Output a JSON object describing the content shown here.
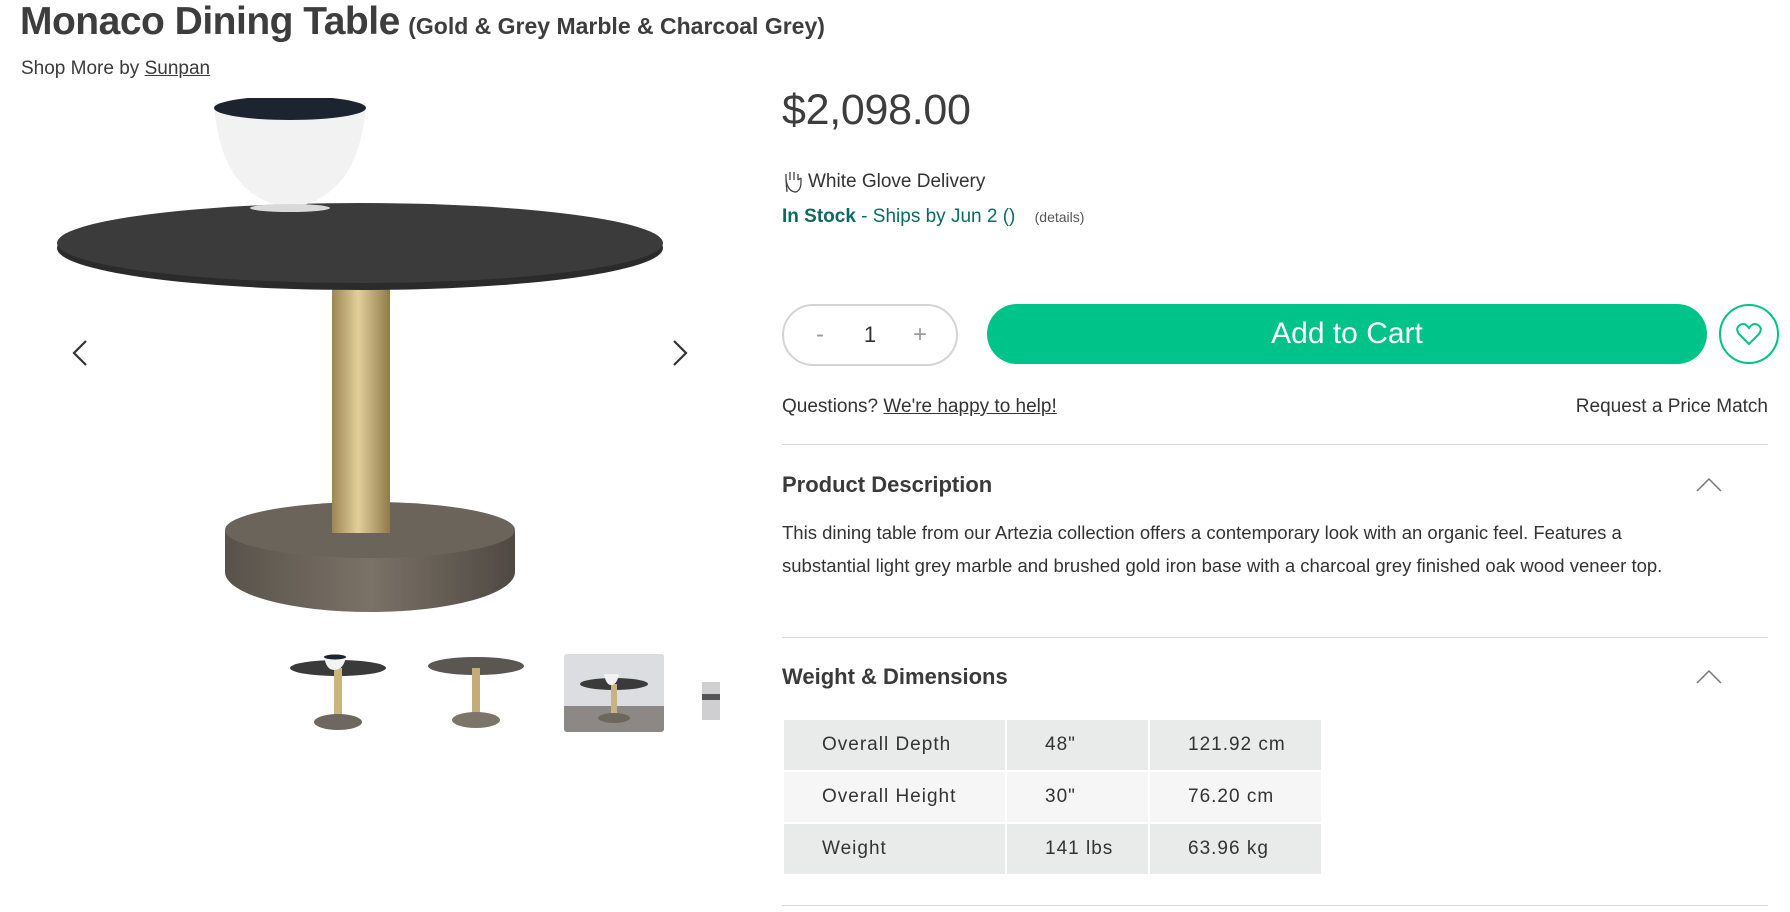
{
  "product": {
    "title": "Monaco Dining Table",
    "variant": "(Gold & Grey Marble & Charcoal Grey)",
    "shop_more_prefix": "Shop More by ",
    "brand": "Sunpan"
  },
  "gallery": {
    "thumbnail_count": 4,
    "selected_thumbnail": 3
  },
  "pricing": {
    "price": "$2,098.00"
  },
  "shipping": {
    "delivery_label": "White Glove Delivery",
    "stock_status": "In Stock",
    "ships_text": " - Ships by Jun 2 ()",
    "details_link": "(details)"
  },
  "cart": {
    "qty_minus": "-",
    "qty_value": "1",
    "qty_plus": "+",
    "add_to_cart": "Add to Cart"
  },
  "help": {
    "questions_prefix": "Questions? ",
    "help_link": "We're happy to help!",
    "price_match": "Request a Price Match"
  },
  "description": {
    "heading": "Product Description",
    "body": "This dining table from our Artezia collection offers a contemporary look with an organic feel. Features a substantial light grey marble and brushed gold iron base with a charcoal grey finished oak wood veneer top."
  },
  "dimensions": {
    "heading": "Weight & Dimensions",
    "rows": [
      [
        "Overall Depth",
        "48\"",
        "121.92 cm"
      ],
      [
        "Overall Height",
        "30\"",
        "76.20 cm"
      ],
      [
        "Weight",
        "141 lbs",
        "63.96 kg"
      ]
    ]
  },
  "colors": {
    "accent": "#00c389",
    "stock_green": "#0b6b5e",
    "text": "#333333"
  }
}
